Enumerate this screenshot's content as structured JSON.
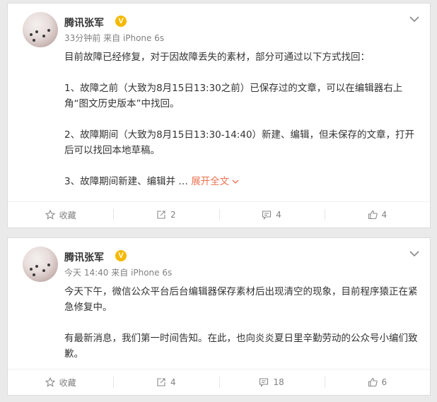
{
  "posts": [
    {
      "author": "腾讯张军",
      "badge": "V",
      "meta": "33分钟前 来自 iPhone 6s",
      "paragraphs": [
        "目前故障已经修复，对于因故障丢失的素材，部分可通过以下方式找回：",
        "1、故障之前（大致为8月15日13:30之前）已保存过的文章，可以在编辑器右上角“图文历史版本”中找回。",
        "2、故障期间（大致为8月15日13:30-14:40）新建、编辑，但未保存的文章，打开后可以找回本地草稿。",
        "3、故障期间新建、编辑并 …"
      ],
      "expand_label": "展开全文",
      "actions": {
        "favorite": "收藏",
        "forward": "2",
        "comment": "4",
        "like": "4"
      }
    },
    {
      "author": "腾讯张军",
      "badge": "V",
      "meta": "今天 14:40 来自 iPhone 6s",
      "paragraphs": [
        "今天下午，微信公众平台后台编辑器保存素材后出现清空的现象，目前程序猿正在紧急修复中。",
        "有最新消息，我们第一时间告知。在此，也向炎炎夏日里辛勤劳动的公众号小编们致歉。"
      ],
      "actions": {
        "favorite": "收藏",
        "forward": "4",
        "comment": "18",
        "like": "6"
      }
    }
  ],
  "colors": {
    "accent": "#eb7350",
    "badge": "#f5b900",
    "muted": "#808080"
  }
}
